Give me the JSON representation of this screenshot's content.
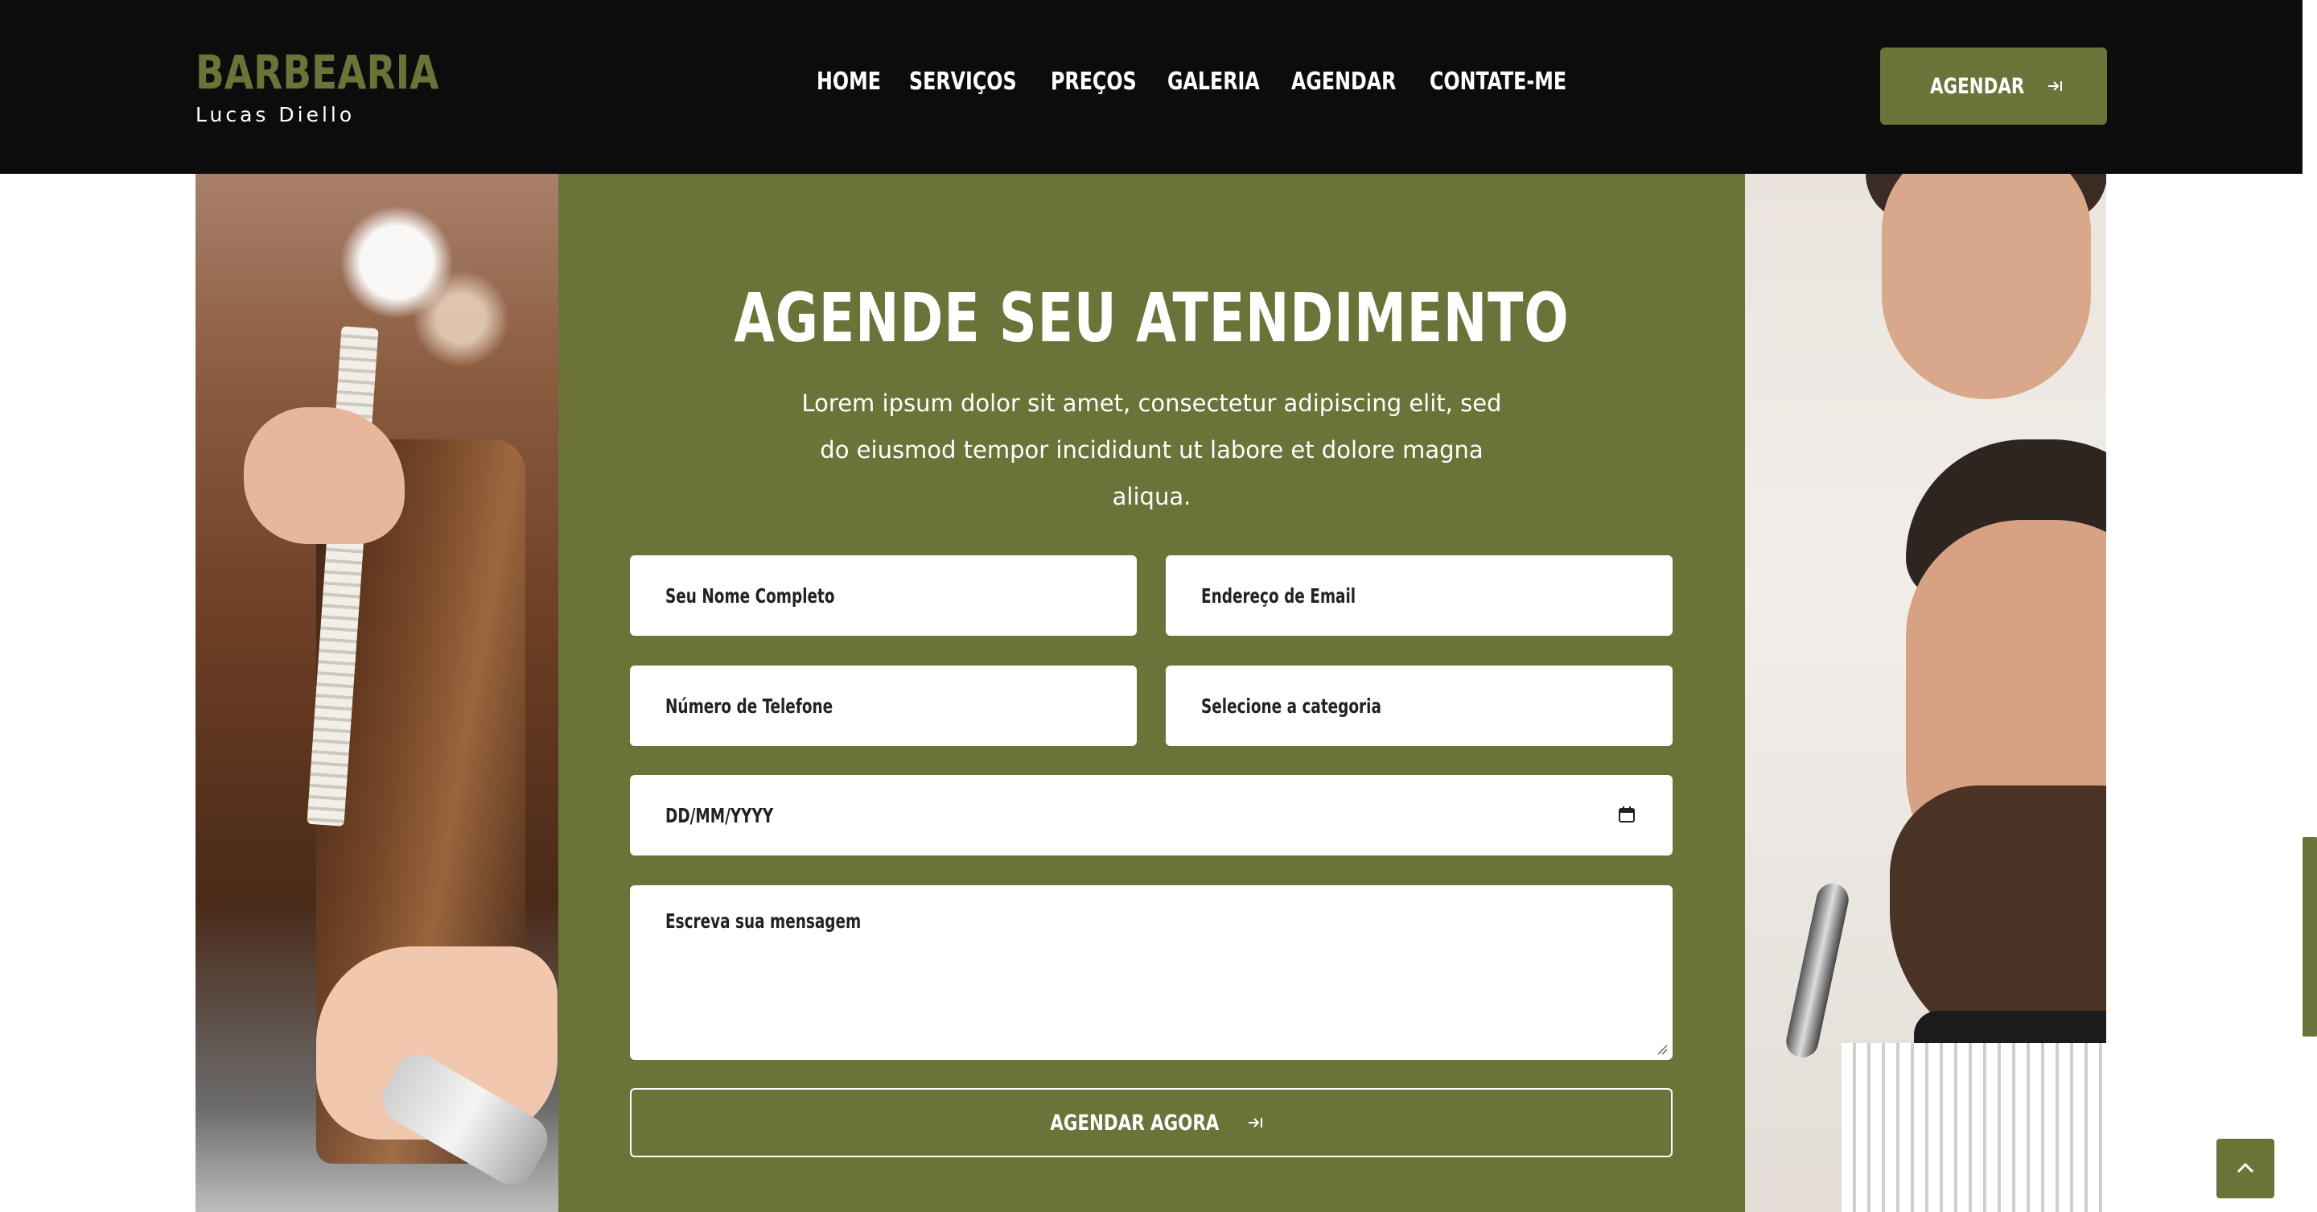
{
  "brand": {
    "title": "BARBEARIA",
    "subtitle": "Lucas Diello"
  },
  "nav": {
    "items": [
      {
        "label": "HOME"
      },
      {
        "label": "SERVIÇOS"
      },
      {
        "label": "PREÇOS"
      },
      {
        "label": "GALERIA"
      },
      {
        "label": "AGENDAR"
      },
      {
        "label": "CONTATE-ME"
      }
    ]
  },
  "header_cta": {
    "label": "AGENDAR",
    "icon": "arrow-right-to-bracket-icon"
  },
  "section": {
    "title": "AGENDE SEU ATENDIMENTO",
    "description": "Lorem ipsum dolor sit amet, consectetur adipiscing elit, sed do eiusmod tempor incididunt ut labore et dolore magna aliqua."
  },
  "form": {
    "name_placeholder": "Seu Nome Completo",
    "email_placeholder": "Endereço de Email",
    "phone_placeholder": "Número de Telefone",
    "category_selected": "Selecione a categoria",
    "date_placeholder": "DD/MM/YYYY",
    "message_placeholder": "Escreva sua mensagem",
    "submit_label": "AGENDAR AGORA"
  },
  "images": {
    "left": "woman-haircut-photo",
    "right": "barber-trimming-beard-photo"
  },
  "colors": {
    "accent": "#6b7339",
    "header_bg": "#0c0c0c",
    "text_light": "#ffffff"
  },
  "scroll_top": {
    "icon": "chevron-up-icon"
  }
}
